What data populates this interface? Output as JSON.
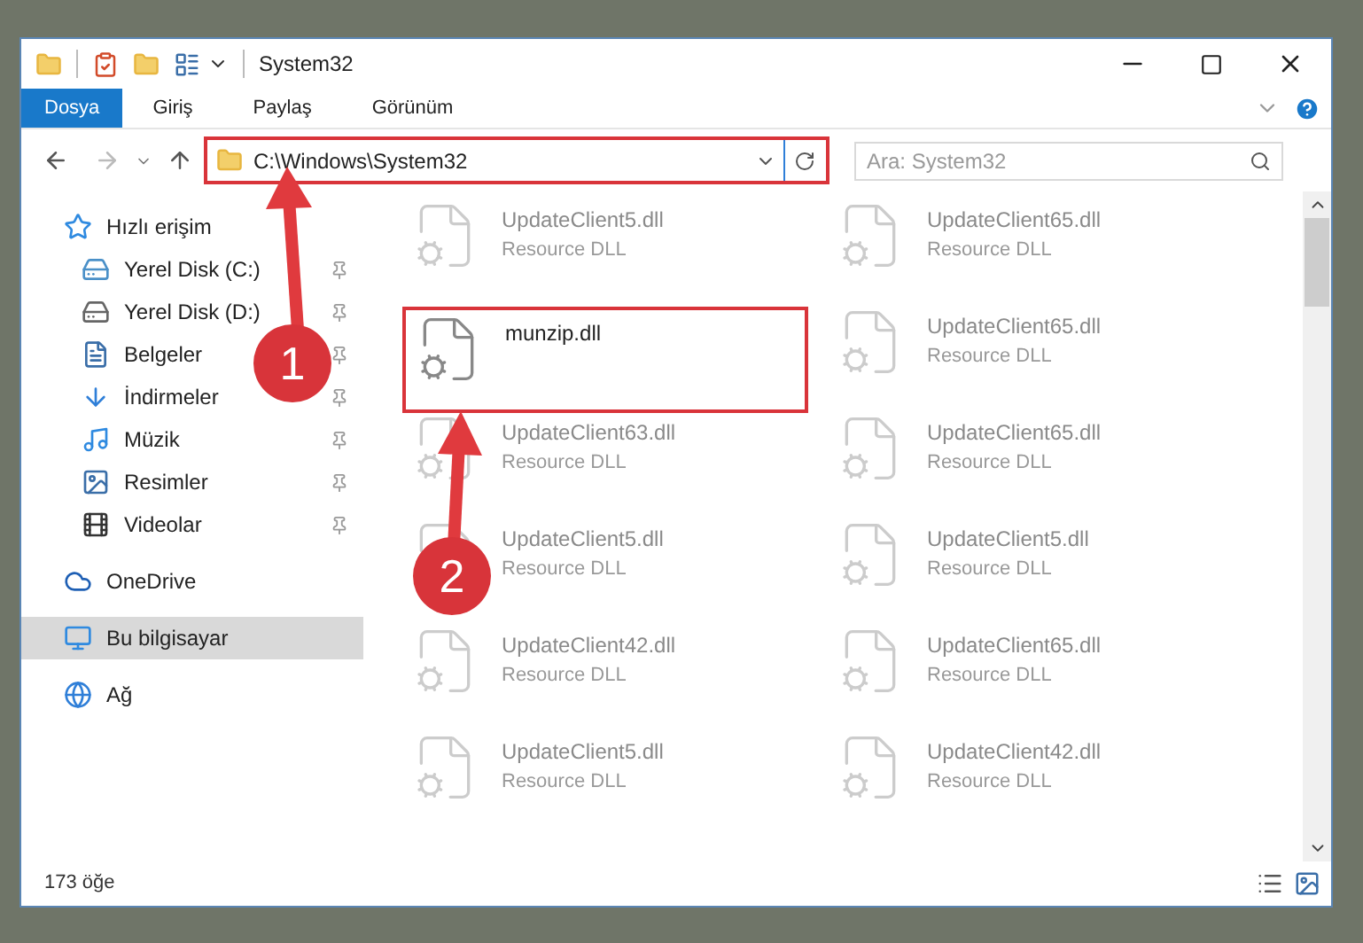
{
  "window": {
    "title": "System32"
  },
  "ribbon_tabs": [
    {
      "label": "Dosya",
      "kind": "file"
    },
    {
      "label": "Giriş",
      "kind": "tab"
    },
    {
      "label": "Paylaş",
      "kind": "tab"
    },
    {
      "label": "Görünüm",
      "kind": "tab"
    }
  ],
  "address": {
    "path": "C:\\Windows\\System32"
  },
  "search": {
    "placeholder": "Ara: System32"
  },
  "sidebar": {
    "items": [
      {
        "label": "Hızlı erişim",
        "selected": false,
        "children": [
          {
            "label": "Yerel Disk (C:)",
            "pinned": true,
            "selected": false
          },
          {
            "label": "Yerel Disk (D:)",
            "pinned": true,
            "selected": false
          },
          {
            "label": "Belgeler",
            "pinned": true,
            "selected": false
          },
          {
            "label": "İndirmeler",
            "pinned": true,
            "selected": false
          },
          {
            "label": "Müzik",
            "pinned": true,
            "selected": false
          },
          {
            "label": "Resimler",
            "pinned": true,
            "selected": false
          },
          {
            "label": "Videolar",
            "pinned": true,
            "selected": false
          }
        ]
      },
      {
        "label": "OneDrive",
        "selected": false
      },
      {
        "label": "Bu bilgisayar",
        "selected": true
      },
      {
        "label": "Ağ",
        "selected": false
      }
    ]
  },
  "files": [
    {
      "name": "UpdateClient5.dll",
      "type": "Resource DLL",
      "kind": "dimmed"
    },
    {
      "name": "UpdateClient65.dll",
      "type": "Resource DLL",
      "kind": "dimmed"
    },
    {
      "name": "munzip.dll",
      "kind": "focus"
    },
    {
      "name": "UpdateClient65.dll",
      "type": "Resource DLL",
      "kind": "dimmed"
    },
    {
      "name": "UpdateClient63.dll",
      "type": "Resource DLL",
      "kind": "dimmed"
    },
    {
      "name": "UpdateClient65.dll",
      "type": "Resource DLL",
      "kind": "dimmed"
    },
    {
      "name": "UpdateClient5.dll",
      "type": "Resource DLL",
      "kind": "dimmed"
    },
    {
      "name": "UpdateClient5.dll",
      "type": "Resource DLL",
      "kind": "dimmed"
    },
    {
      "name": "UpdateClient42.dll",
      "type": "Resource DLL",
      "kind": "dimmed"
    },
    {
      "name": "UpdateClient65.dll",
      "type": "Resource DLL",
      "kind": "dimmed"
    },
    {
      "name": "UpdateClient5.dll",
      "type": "Resource DLL",
      "kind": "dimmed"
    },
    {
      "name": "UpdateClient42.dll",
      "type": "Resource DLL",
      "kind": "dimmed"
    }
  ],
  "status_bar": {
    "count": "173 öğe"
  },
  "annotations": [
    {
      "label": "1"
    },
    {
      "label": "2"
    }
  ]
}
